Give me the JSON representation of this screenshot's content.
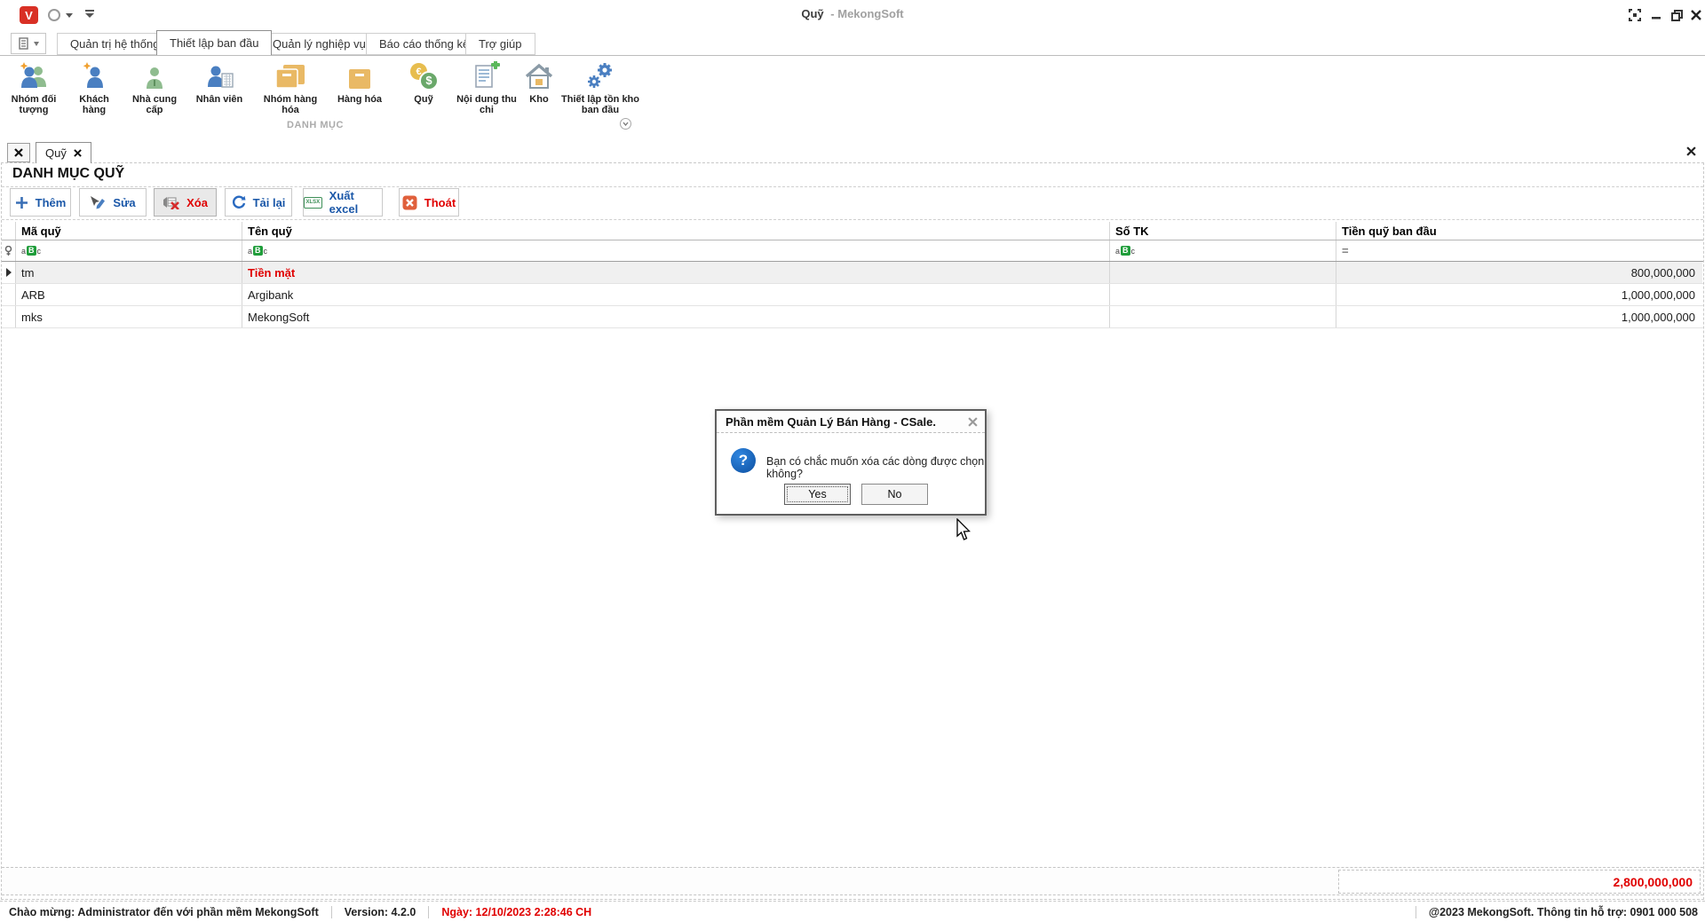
{
  "titlebar": {
    "title_primary": "Quỹ",
    "title_secondary": "- MekongSoft",
    "logo_letter": "V"
  },
  "ribbon": {
    "tabs": [
      {
        "label": "Quản trị hệ thống"
      },
      {
        "label": "Thiết lập ban đầu"
      },
      {
        "label": "Quản lý nghiệp vụ"
      },
      {
        "label": "Báo cáo thống kê"
      },
      {
        "label": "Trợ giúp"
      }
    ],
    "active_tab": "Thiết lập ban đầu",
    "group_label": "DANH MỤC",
    "items": [
      {
        "label": "Nhóm đối tượng",
        "icon": "group-people"
      },
      {
        "label": "Khách hàng",
        "icon": "customer-person"
      },
      {
        "label": "Nhà cung cấp",
        "icon": "supplier-person"
      },
      {
        "label": "Nhân viên",
        "icon": "employee-person-doc"
      },
      {
        "label": "Nhóm hàng hóa",
        "icon": "goods-group-boxes"
      },
      {
        "label": "Hàng hóa",
        "icon": "goods-box"
      },
      {
        "label": "Quỹ",
        "icon": "coins"
      },
      {
        "label": "Nội dung thu chi",
        "icon": "document-plus"
      },
      {
        "label": "Kho",
        "icon": "warehouse-house"
      },
      {
        "label": "Thiết lập tồn kho ban đầu",
        "icon": "gears"
      }
    ]
  },
  "tabstrip": {
    "tab_label": "Quỹ"
  },
  "panel": {
    "title": "DANH MỤC QUỸ"
  },
  "toolbar": {
    "add_label": "Thêm",
    "edit_label": "Sửa",
    "delete_label": "Xóa",
    "reload_label": "Tải lại",
    "export_label": "Xuất excel",
    "exit_label": "Thoát",
    "excel_icon_text": "XLSX"
  },
  "grid": {
    "columns": [
      "Mã quỹ",
      "Tên quỹ",
      "Số TK",
      "Tiền quỹ ban đầu"
    ],
    "filter_icons": {
      "a": "a",
      "B": "B",
      "c": "c",
      "equals": "="
    },
    "rows": [
      {
        "code": "tm",
        "name": "Tiền mặt",
        "account": "",
        "amount": "800,000,000",
        "selected": true,
        "highlight": "yellow"
      },
      {
        "code": "ARB",
        "name": "Argibank",
        "account": "",
        "amount": "1,000,000,000",
        "selected": false
      },
      {
        "code": "mks",
        "name": "MekongSoft",
        "account": "",
        "amount": "1,000,000,000",
        "selected": false
      }
    ],
    "footer_total": "2,800,000,000"
  },
  "dialog": {
    "title": "Phần mềm Quản Lý Bán Hàng - CSale.",
    "message": "Bạn có chắc muốn xóa các dòng được chọn không?",
    "icon_char": "?",
    "yes_label": "Yes",
    "no_label": "No"
  },
  "statusbar": {
    "welcome": "Chào mừng: Administrator đến với phần mềm MekongSoft",
    "version": "Version: 4.2.0",
    "date": "Ngày: 12/10/2023 2:28:46 CH",
    "support": "@2023 MekongSoft. Thông tin hỗ trợ: 0901 000 508"
  },
  "icons": {
    "euro": "€",
    "dollar": "$"
  },
  "colors": {
    "accent_blue": "#1a57a8",
    "danger_red": "#e00000",
    "highlight_yellow": "#ffff00",
    "green_filter": "#1f9d3a",
    "orange_box": "#e9b965",
    "logo_red": "#d93025"
  }
}
